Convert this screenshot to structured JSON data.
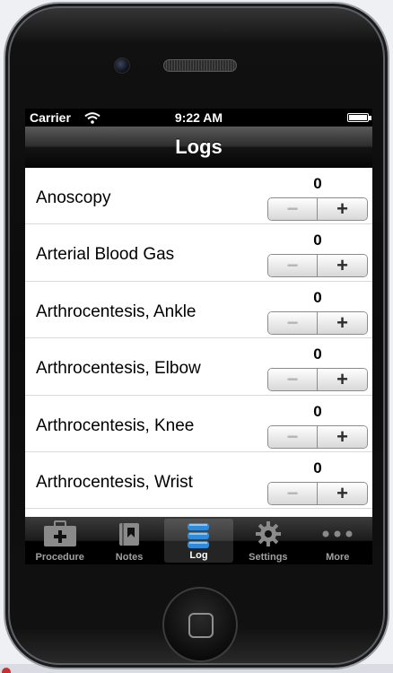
{
  "status_bar": {
    "carrier": "Carrier",
    "time": "9:22 AM"
  },
  "nav": {
    "title": "Logs"
  },
  "procedures": [
    {
      "name": "Anoscopy",
      "count": "0"
    },
    {
      "name": "Arterial Blood Gas",
      "count": "0"
    },
    {
      "name": "Arthrocentesis, Ankle",
      "count": "0"
    },
    {
      "name": "Arthrocentesis, Elbow",
      "count": "0"
    },
    {
      "name": "Arthrocentesis, Knee",
      "count": "0"
    },
    {
      "name": "Arthrocentesis, Wrist",
      "count": "0"
    }
  ],
  "stepper": {
    "minus": "−",
    "plus": "+"
  },
  "tabs": [
    {
      "label": "Procedure",
      "icon": "medical-kit-icon",
      "selected": false
    },
    {
      "label": "Notes",
      "icon": "notebook-icon",
      "selected": false
    },
    {
      "label": "Log",
      "icon": "database-icon",
      "selected": true
    },
    {
      "label": "Settings",
      "icon": "gear-icon",
      "selected": false
    },
    {
      "label": "More",
      "icon": "more-dots-icon",
      "selected": false
    }
  ],
  "colors": {
    "tab_selected_icon": "#2f8bd8",
    "tab_unselected_icon": "#8a8a8a"
  }
}
